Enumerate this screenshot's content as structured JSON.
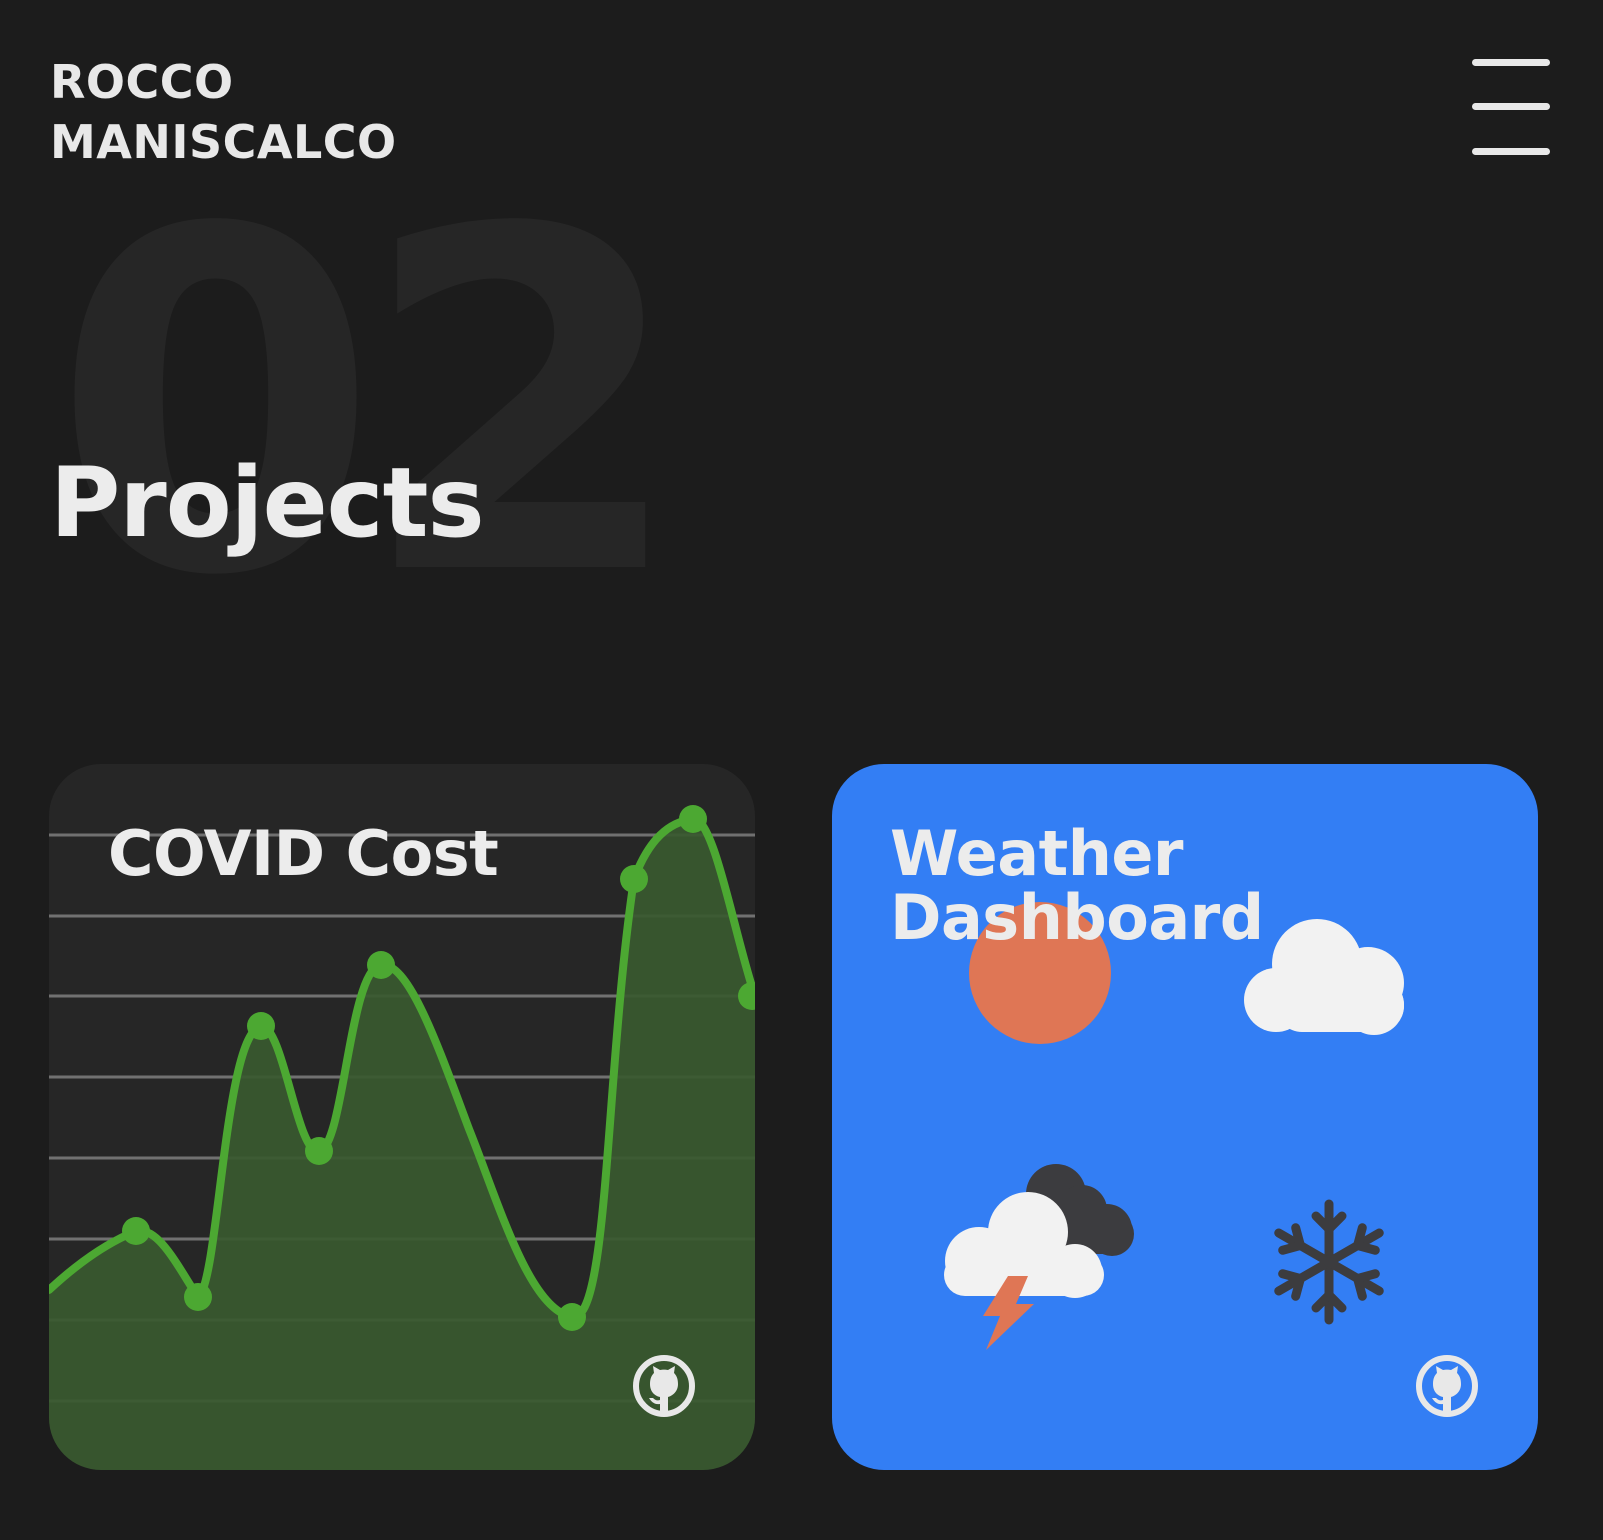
{
  "header": {
    "logo_line1": "ROCCO",
    "logo_line2": "MANISCALCO",
    "menu_icon": "hamburger-icon"
  },
  "section": {
    "number": "02",
    "title": "Projects"
  },
  "projects": [
    {
      "title": "COVID Cost",
      "background": "#262626",
      "line_color": "#4ca832",
      "fill_color": "#38592f",
      "link_icon": "github-icon"
    },
    {
      "title_line1": "Weather",
      "title_line2": "Dashboard",
      "background": "#337ef4",
      "sun_color": "#df7655",
      "icons": [
        "sun-icon",
        "cloud-icon",
        "thunderstorm-icon",
        "snowflake-icon"
      ],
      "link_icon": "github-icon"
    }
  ]
}
